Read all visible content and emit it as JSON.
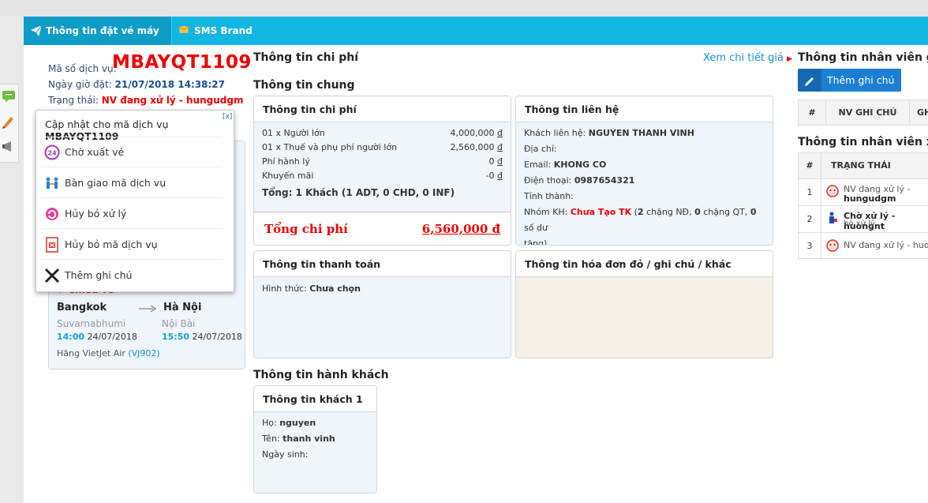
{
  "tabs": [
    {
      "label": "Thông tin đặt vé máy bay",
      "icon": "paper-plane-icon"
    },
    {
      "label": "SMS Brand Name",
      "icon": "envelope-icon"
    }
  ],
  "service": {
    "code_label": "Mã số dịch vụ:",
    "code": "MBAYQT1109",
    "date_label": "Ngày giờ đặt:",
    "date": "21/07/2018 14:38:27",
    "status_label": "Trạng thái:",
    "status": "NV đang xử lý - hungudgm"
  },
  "popup": {
    "title": "Cập nhật cho mã dịch vụ",
    "code": "MBAYQT1109",
    "close": "[x]",
    "items": [
      {
        "label": "Chờ xuất vé",
        "icon": "clock-24-icon"
      },
      {
        "label": "Bàn giao mã dịch vụ",
        "icon": "handover-icon"
      },
      {
        "label": "Hủy bỏ xử lý",
        "icon": "recycle-icon"
      },
      {
        "label": "Hủy bỏ mã dịch vụ",
        "icon": "cancel-doc-icon"
      },
      {
        "label": "Thêm ghi chú",
        "icon": "cross-tools-icon"
      }
    ]
  },
  "flight": {
    "header": "Chiều về",
    "from": "Bangkok",
    "to": "Hà Nội",
    "from_airport": "Suvarnabhumi",
    "to_airport": "Nội Bài",
    "dep_time": "14:00",
    "dep_date": "24/07/2018",
    "arr_time": "15:50",
    "arr_date": "24/07/2018",
    "airline": "Hãng VietJet Air",
    "flight_no": "(VJ902)"
  },
  "cost": {
    "title": "Thông tin chi phí",
    "detail_link": "Xem chi tiết giá",
    "general_title": "Thông tin chung",
    "card_title": "Thông tin chi phí",
    "lines": [
      {
        "label": "01 x Người lớn",
        "value": "4,000,000"
      },
      {
        "label": "01 x Thuế và phụ phí người lớn",
        "value": "2,560,000"
      },
      {
        "label": "Phí hành lý",
        "value": "0"
      },
      {
        "label": "Khuyến mãi",
        "value": "-0"
      }
    ],
    "currency": "đ",
    "total_pax": "Tổng: 1 Khách (1 ADT, 0 CHD, 0 INF)",
    "total_label": "Tổng chi phí",
    "total_value": "6,560,000 đ"
  },
  "contact": {
    "title": "Thông tin liên hệ",
    "name_label": "Khách liên hệ:",
    "name": "NGUYEN THANH VINH",
    "address_label": "Địa chỉ:",
    "email_label": "Email:",
    "email": "KHONG CO",
    "phone_label": "Điện thoại:",
    "phone": "0987654321",
    "province_label": "Tỉnh thành:",
    "group_label": "Nhóm KH:",
    "group": "Chưa Tạo TK",
    "group_detail_open": "(",
    "g1": "2",
    "g1_text": " chặng NĐ, ",
    "g2": "0",
    "g2_text": " chặng QT, ",
    "g3": "0",
    "g3_text": " số dư",
    "g_last": "tặng)"
  },
  "payment": {
    "title": "Thông tin thanh toán",
    "method_label": "Hình thức:",
    "method": "Chưa chọn"
  },
  "invoice": {
    "title": "Thông tin hóa đơn đỏ / ghi chú / khác"
  },
  "passenger": {
    "section": "Thông tin hành khách",
    "title": "Thông tin khách 1",
    "last_label": "Họ:",
    "last": "nguyen",
    "first_label": "Tên:",
    "first": "thanh vinh",
    "dob_label": "Ngày sinh:"
  },
  "staff_notes": {
    "title": "Thông tin nhân viên ghi",
    "add_button": "Thêm ghi chú",
    "col_num": "#",
    "col_staff": "NV GHI CHÚ",
    "col_extra": "GH"
  },
  "staff_process": {
    "title": "Thông tin nhân viên xử",
    "col_num": "#",
    "col_status": "TRẠNG THÁI",
    "rows": [
      {
        "num": "1",
        "status": "NV đang xử lý -",
        "user": "hungudgm"
      },
      {
        "num": "2",
        "status": "Chờ xử lý - huongnt",
        "user": "bỏ xử lý"
      },
      {
        "num": "3",
        "status": "NV đang xử lý - huon",
        "user": ""
      }
    ]
  }
}
